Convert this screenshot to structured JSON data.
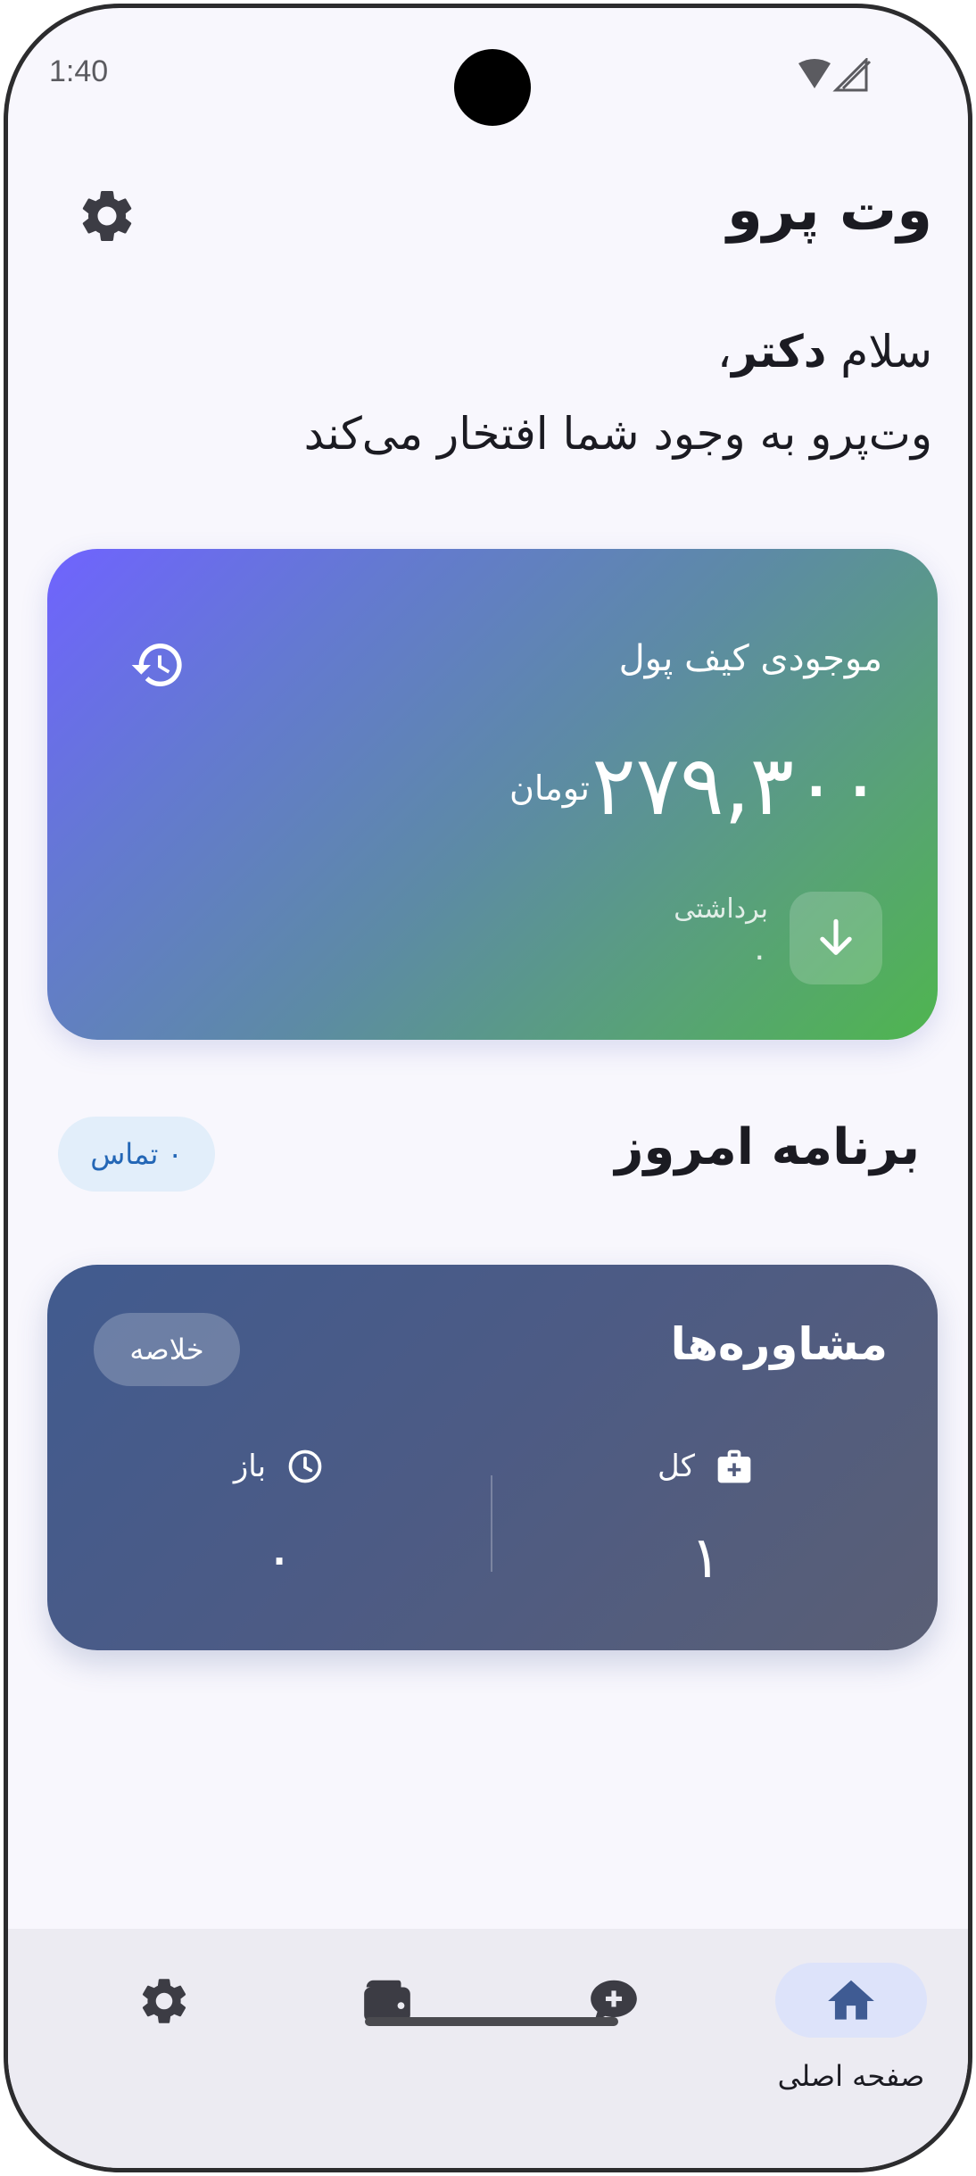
{
  "status": {
    "time": "1:40"
  },
  "header": {
    "title": "وت پرو"
  },
  "greeting": {
    "prefix": "سلام ",
    "name": "دکتر",
    "suffix": "،",
    "subtitle": "وت‌پرو به وجود شما افتخار می‌کند"
  },
  "wallet": {
    "label": "موجودی کیف پول",
    "amount": "۲۷۹,۳۰۰",
    "currency": "تومان",
    "withdraw_label": "برداشتی",
    "withdraw_value": "۰"
  },
  "today": {
    "title": "برنامه امروز",
    "contacts_badge": "۰ تماس"
  },
  "consultations": {
    "title": "مشاوره‌ها",
    "summary_button": "خلاصه",
    "total_label": "کل",
    "total_value": "۱",
    "open_label": "باز",
    "open_value": "۰"
  },
  "nav": {
    "home": "صفحه اصلی"
  },
  "colors": {
    "wallet_gradient_start": "#6f63ff",
    "wallet_gradient_end": "#4fb54f",
    "consult_gradient_start": "#415b8f",
    "consult_gradient_end": "#5a5f75",
    "nav_active": "#3f5b93",
    "icon_dark": "#3c3c44"
  },
  "icons": [
    "wifi-icon",
    "no-signal-icon",
    "gear-icon",
    "history-icon",
    "arrow-down-icon",
    "medical-bag-icon",
    "clock-icon",
    "home-icon",
    "chat-plus-icon",
    "wallet-icon"
  ]
}
